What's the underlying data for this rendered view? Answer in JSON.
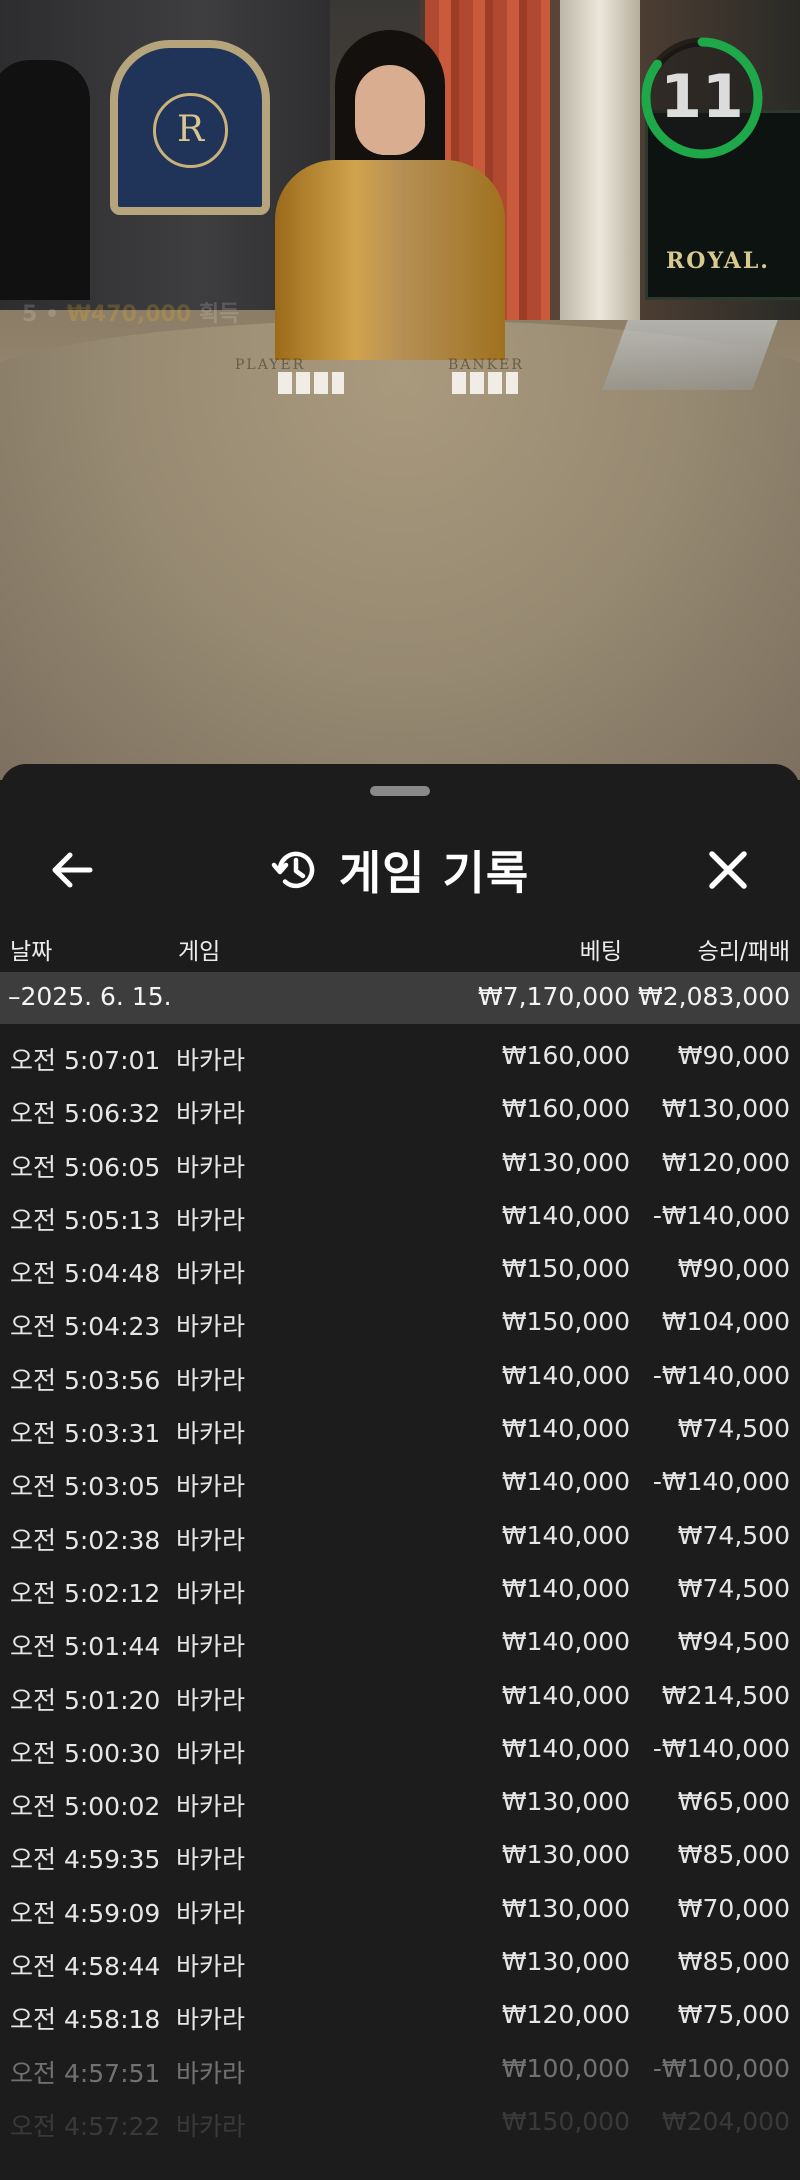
{
  "video": {
    "timer_value": "11",
    "timer_color": "#1ea84a",
    "ticker_prefix": "5 • ",
    "ticker_amount": "₩470,000",
    "ticker_suffix": " 획득",
    "emblem_letter": "R",
    "sign_text": "ROYAL.",
    "table_player": "PLAYER",
    "table_banker": "BANKER"
  },
  "header": {
    "title": "게임 기록",
    "back_icon": "arrow-left-icon",
    "history_icon": "history-icon",
    "close_icon": "close-icon"
  },
  "columns": {
    "date": "날짜",
    "game": "게임",
    "bet": "베팅",
    "result": "승리/패배"
  },
  "group": {
    "date": "–2025. 6. 15.",
    "bet_total": "₩7,170,000",
    "result_total": "₩2,083,000"
  },
  "rows": [
    {
      "time": "오전 5:07:01",
      "game": "바카라",
      "bet": "₩160,000",
      "result": "₩90,000"
    },
    {
      "time": "오전 5:06:32",
      "game": "바카라",
      "bet": "₩160,000",
      "result": "₩130,000"
    },
    {
      "time": "오전 5:06:05",
      "game": "바카라",
      "bet": "₩130,000",
      "result": "₩120,000"
    },
    {
      "time": "오전 5:05:13",
      "game": "바카라",
      "bet": "₩140,000",
      "result": "-₩140,000"
    },
    {
      "time": "오전 5:04:48",
      "game": "바카라",
      "bet": "₩150,000",
      "result": "₩90,000"
    },
    {
      "time": "오전 5:04:23",
      "game": "바카라",
      "bet": "₩150,000",
      "result": "₩104,000"
    },
    {
      "time": "오전 5:03:56",
      "game": "바카라",
      "bet": "₩140,000",
      "result": "-₩140,000"
    },
    {
      "time": "오전 5:03:31",
      "game": "바카라",
      "bet": "₩140,000",
      "result": "₩74,500"
    },
    {
      "time": "오전 5:03:05",
      "game": "바카라",
      "bet": "₩140,000",
      "result": "-₩140,000"
    },
    {
      "time": "오전 5:02:38",
      "game": "바카라",
      "bet": "₩140,000",
      "result": "₩74,500"
    },
    {
      "time": "오전 5:02:12",
      "game": "바카라",
      "bet": "₩140,000",
      "result": "₩74,500"
    },
    {
      "time": "오전 5:01:44",
      "game": "바카라",
      "bet": "₩140,000",
      "result": "₩94,500"
    },
    {
      "time": "오전 5:01:20",
      "game": "바카라",
      "bet": "₩140,000",
      "result": "₩214,500"
    },
    {
      "time": "오전 5:00:30",
      "game": "바카라",
      "bet": "₩140,000",
      "result": "-₩140,000"
    },
    {
      "time": "오전 5:00:02",
      "game": "바카라",
      "bet": "₩130,000",
      "result": "₩65,000"
    },
    {
      "time": "오전 4:59:35",
      "game": "바카라",
      "bet": "₩130,000",
      "result": "₩85,000"
    },
    {
      "time": "오전 4:59:09",
      "game": "바카라",
      "bet": "₩130,000",
      "result": "₩70,000"
    },
    {
      "time": "오전 4:58:44",
      "game": "바카라",
      "bet": "₩130,000",
      "result": "₩85,000"
    },
    {
      "time": "오전 4:58:18",
      "game": "바카라",
      "bet": "₩120,000",
      "result": "₩75,000"
    },
    {
      "time": "오전 4:57:51",
      "game": "바카라",
      "bet": "₩100,000",
      "result": "-₩100,000"
    },
    {
      "time": "오전 4:57:22",
      "game": "바카라",
      "bet": "₩150,000",
      "result": "₩204,000"
    }
  ]
}
